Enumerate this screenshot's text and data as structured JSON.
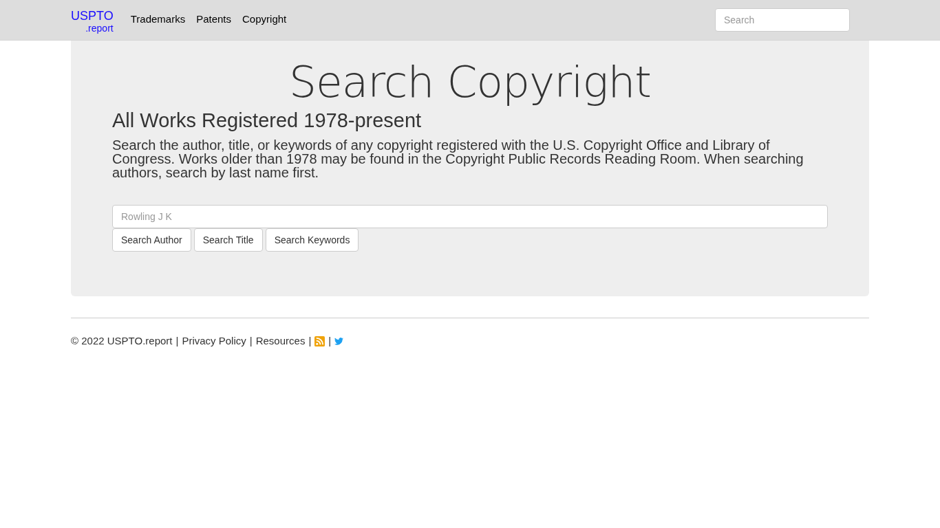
{
  "navbar": {
    "brand": "USPTO",
    "brand_sub": ".report",
    "links": [
      "Trademarks",
      "Patents",
      "Copyright"
    ],
    "search": {
      "placeholder": "Search"
    }
  },
  "hero": {
    "title": "Search Copyright",
    "subtitle": "All Works Registered 1978-present",
    "description": "Search the author, title, or keywords of any copyright registered with the U.S. Copyright Office and Library of Congress. Works older than 1978 may be found in the Copyright Public Records Reading Room. When searching authors, search by last name first.",
    "search": {
      "placeholder": "Rowling J K"
    },
    "buttons": [
      "Search Author",
      "Search Title",
      "Search Keywords"
    ]
  },
  "footer": [
    {
      "kind": "text",
      "text": "© 2022 USPTO.report"
    },
    {
      "kind": "separator",
      "text": "|"
    },
    {
      "kind": "link",
      "text": "Privacy Policy"
    },
    {
      "kind": "separator",
      "text": "|"
    },
    {
      "kind": "link",
      "text": "Resources"
    },
    {
      "kind": "separator",
      "text": "|"
    },
    {
      "kind": "rss"
    },
    {
      "kind": "separator",
      "text": "|"
    },
    {
      "kind": "bird"
    }
  ]
}
